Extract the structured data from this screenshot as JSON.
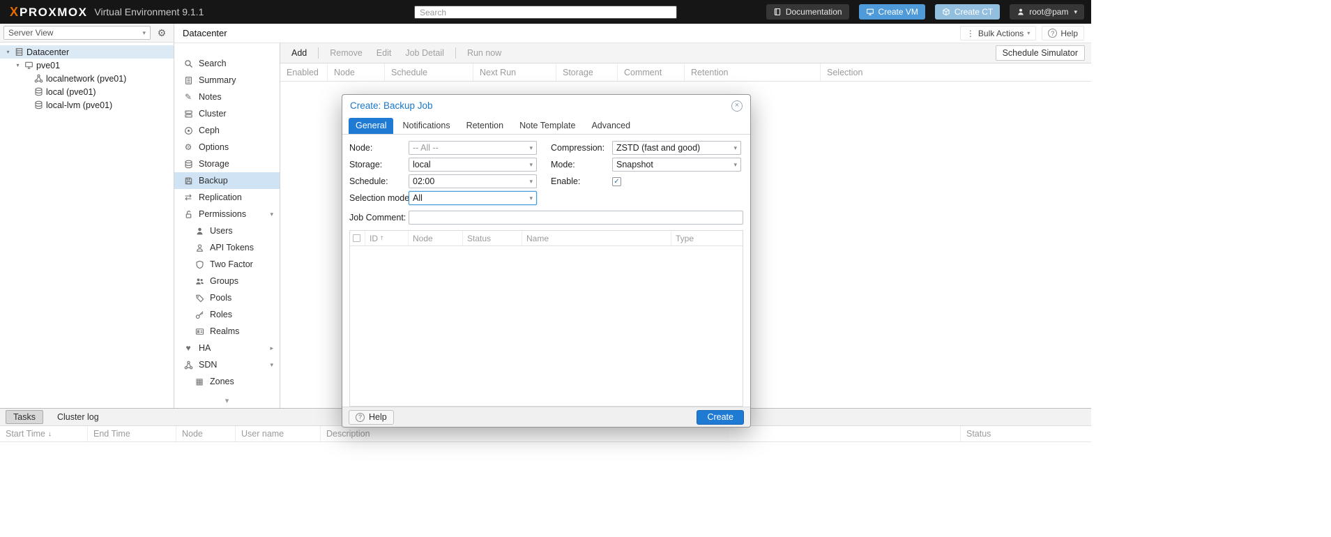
{
  "colors": {
    "accent_blue": "#1f7ad4",
    "logo_orange": "#e66b00",
    "selected_row_blue": "#cfe3f4",
    "header_black": "#161616"
  },
  "icons": {
    "logo_mark": "X",
    "caret_down": "▾",
    "chevron_right": "▸",
    "gear": "⚙",
    "dots": "⋮",
    "question": "?",
    "close": "×",
    "pencil": "✎",
    "heart": "♥",
    "swap": "⇄",
    "grid": "▦",
    "sort_asc": "↑",
    "sort_desc": "↓",
    "check": "✓"
  },
  "header": {
    "logo_text": "PROXMOX",
    "version": "Virtual Environment 9.1.1",
    "search_placeholder": "Search",
    "documentation": "Documentation",
    "create_vm": "Create VM",
    "create_ct": "Create CT",
    "user": "root@pam"
  },
  "sidebar": {
    "view_selector": "Server View",
    "tree": [
      {
        "label": "Datacenter"
      },
      {
        "label": "pve01"
      },
      {
        "label": "localnetwork (pve01)"
      },
      {
        "label": "local (pve01)"
      },
      {
        "label": "local-lvm (pve01)"
      }
    ]
  },
  "content_header": {
    "breadcrumb": "Datacenter",
    "bulk_actions": "Bulk Actions",
    "help": "Help"
  },
  "nav": {
    "items": [
      {
        "label": "Search"
      },
      {
        "label": "Summary"
      },
      {
        "label": "Notes"
      },
      {
        "label": "Cluster"
      },
      {
        "label": "Ceph"
      },
      {
        "label": "Options"
      },
      {
        "label": "Storage"
      },
      {
        "label": "Backup"
      },
      {
        "label": "Replication"
      },
      {
        "label": "Permissions"
      },
      {
        "label": "Users"
      },
      {
        "label": "API Tokens"
      },
      {
        "label": "Two Factor"
      },
      {
        "label": "Groups"
      },
      {
        "label": "Pools"
      },
      {
        "label": "Roles"
      },
      {
        "label": "Realms"
      },
      {
        "label": "HA"
      },
      {
        "label": "SDN"
      },
      {
        "label": "Zones"
      }
    ]
  },
  "toolbar": {
    "add": "Add",
    "remove": "Remove",
    "edit": "Edit",
    "job_detail": "Job Detail",
    "run_now": "Run now",
    "schedule_simulator": "Schedule Simulator"
  },
  "jobs_grid": {
    "columns": [
      "Enabled",
      "Node",
      "Schedule",
      "Next Run",
      "Storage",
      "Comment",
      "Retention",
      "Selection"
    ]
  },
  "modal": {
    "title": "Create: Backup Job",
    "tabs": [
      "General",
      "Notifications",
      "Retention",
      "Note Template",
      "Advanced"
    ],
    "form": {
      "node_label": "Node:",
      "node_value": "-- All --",
      "storage_label": "Storage:",
      "storage_value": "local",
      "schedule_label": "Schedule:",
      "schedule_value": "02:00",
      "selection_mode_label": "Selection mode:",
      "selection_mode_value": "All",
      "compression_label": "Compression:",
      "compression_value": "ZSTD (fast and good)",
      "mode_label": "Mode:",
      "mode_value": "Snapshot",
      "enable_label": "Enable:",
      "job_comment_label": "Job Comment:",
      "job_comment_value": ""
    },
    "grid": {
      "columns": [
        "ID",
        "Node",
        "Status",
        "Name",
        "Type"
      ]
    },
    "help": "Help",
    "create": "Create"
  },
  "tasks_panel": {
    "tasks_tab": "Tasks",
    "cluster_log_tab": "Cluster log",
    "columns": [
      "Start Time",
      "End Time",
      "Node",
      "User name",
      "Description",
      "Status"
    ]
  }
}
